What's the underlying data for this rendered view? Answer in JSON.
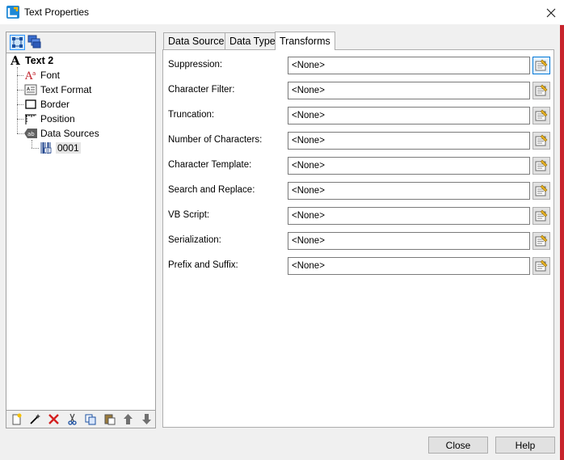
{
  "window": {
    "title": "Text Properties"
  },
  "tree": {
    "root": "Text 2",
    "items": [
      {
        "label": "Font",
        "icon": "font-icon"
      },
      {
        "label": "Text Format",
        "icon": "text-format-icon"
      },
      {
        "label": "Border",
        "icon": "border-icon"
      },
      {
        "label": "Position",
        "icon": "position-icon"
      },
      {
        "label": "Data Sources",
        "icon": "data-sources-icon"
      }
    ],
    "child": {
      "label": "0001",
      "icon": "barcode-source-icon"
    }
  },
  "tabs": [
    {
      "label": "Data Source"
    },
    {
      "label": "Data Type"
    },
    {
      "label": "Transforms"
    }
  ],
  "transforms": [
    {
      "label": "Suppression:",
      "value": "<None>"
    },
    {
      "label": "Character Filter:",
      "value": "<None>"
    },
    {
      "label": "Truncation:",
      "value": "<None>"
    },
    {
      "label": "Number of Characters:",
      "value": "<None>"
    },
    {
      "label": "Character Template:",
      "value": "<None>"
    },
    {
      "label": "Search and Replace:",
      "value": "<None>"
    },
    {
      "label": "VB Script:",
      "value": "<None>"
    },
    {
      "label": "Serialization:",
      "value": "<None>"
    },
    {
      "label": "Prefix and Suffix:",
      "value": "<None>"
    }
  ],
  "buttons": {
    "close": "Close",
    "help": "Help"
  }
}
